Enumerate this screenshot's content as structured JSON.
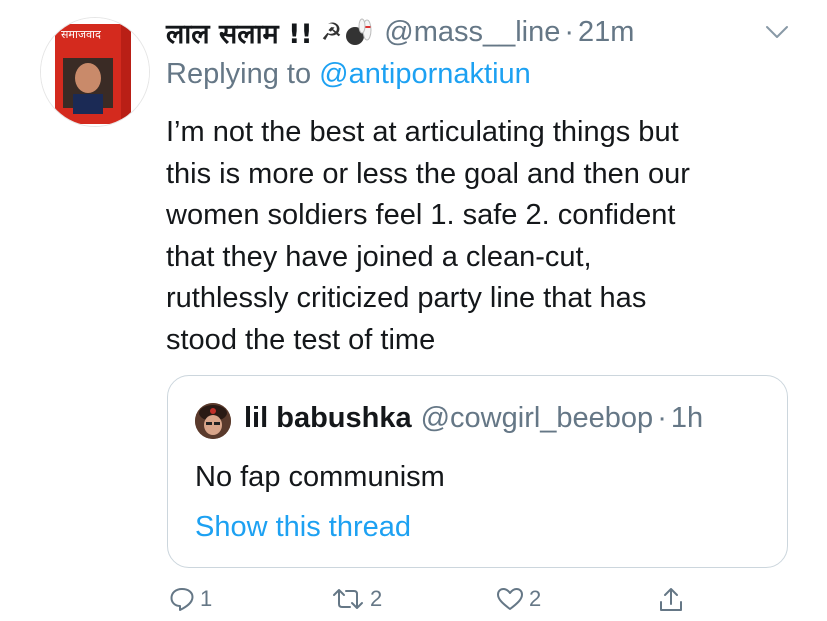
{
  "tweet": {
    "display_name": "लाल सलाम !!",
    "name_emojis": "☭🎳",
    "handle": "@mass__line",
    "separator": "·",
    "time": "21m",
    "replying_prefix": "Replying to ",
    "replying_to": "@antipornaktiun",
    "text_lines": [
      "I’m not the best at articulating things but",
      "this is more or less the goal and then our",
      "women soldiers feel 1. safe 2. confident",
      "that they have joined a clean-cut,",
      "ruthlessly criticized party line that has",
      "stood the test of time"
    ],
    "avatar_caption": "समाजवाद"
  },
  "quote": {
    "name": "lil babushka",
    "handle": "@cowgirl_beebop",
    "separator": "·",
    "time": "1h",
    "text": "No fap communism",
    "link": "Show this thread"
  },
  "actions": {
    "reply_count": "1",
    "retweet_count": "2",
    "like_count": "2"
  },
  "colors": {
    "text": "#14171a",
    "muted": "#657786",
    "link": "#1da1f2",
    "border": "#ccd6dd"
  }
}
